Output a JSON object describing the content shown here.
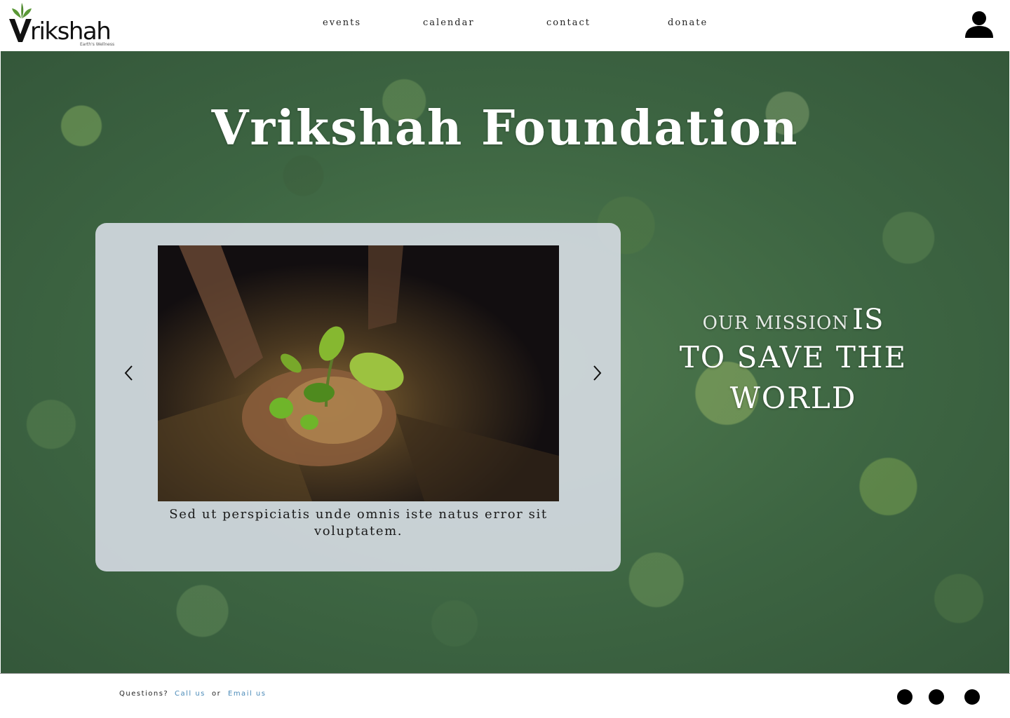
{
  "brand": {
    "logo_text": "rikshah",
    "logo_tagline": "Earth's Wellness",
    "logo_icon": "leaf-v-logo-icon"
  },
  "nav": {
    "items": [
      {
        "label": "events"
      },
      {
        "label": "calendar"
      },
      {
        "label": "contact"
      },
      {
        "label": "donate"
      }
    ],
    "user_icon": "user-icon"
  },
  "hero": {
    "title": "Vrikshah Foundation",
    "carousel": {
      "image_icon": "seedling-hands-photo",
      "caption": "Sed ut perspiciatis unde omnis iste natus error sit voluptatem.",
      "prev_icon": "chevron-left-icon",
      "next_icon": "chevron-right-icon"
    },
    "mission": {
      "small": "OUR MISSION",
      "big": "IS",
      "line2": "TO SAVE THE WORLD"
    }
  },
  "footer": {
    "questions": "Questions?",
    "call": "Call us",
    "or": "or",
    "email": "Email us",
    "social_icons": [
      "social-icon-1",
      "social-icon-2",
      "social-icon-3"
    ]
  },
  "colors": {
    "link": "#4a8ab8",
    "card": "#dee2ec",
    "forest": "#426a45"
  }
}
